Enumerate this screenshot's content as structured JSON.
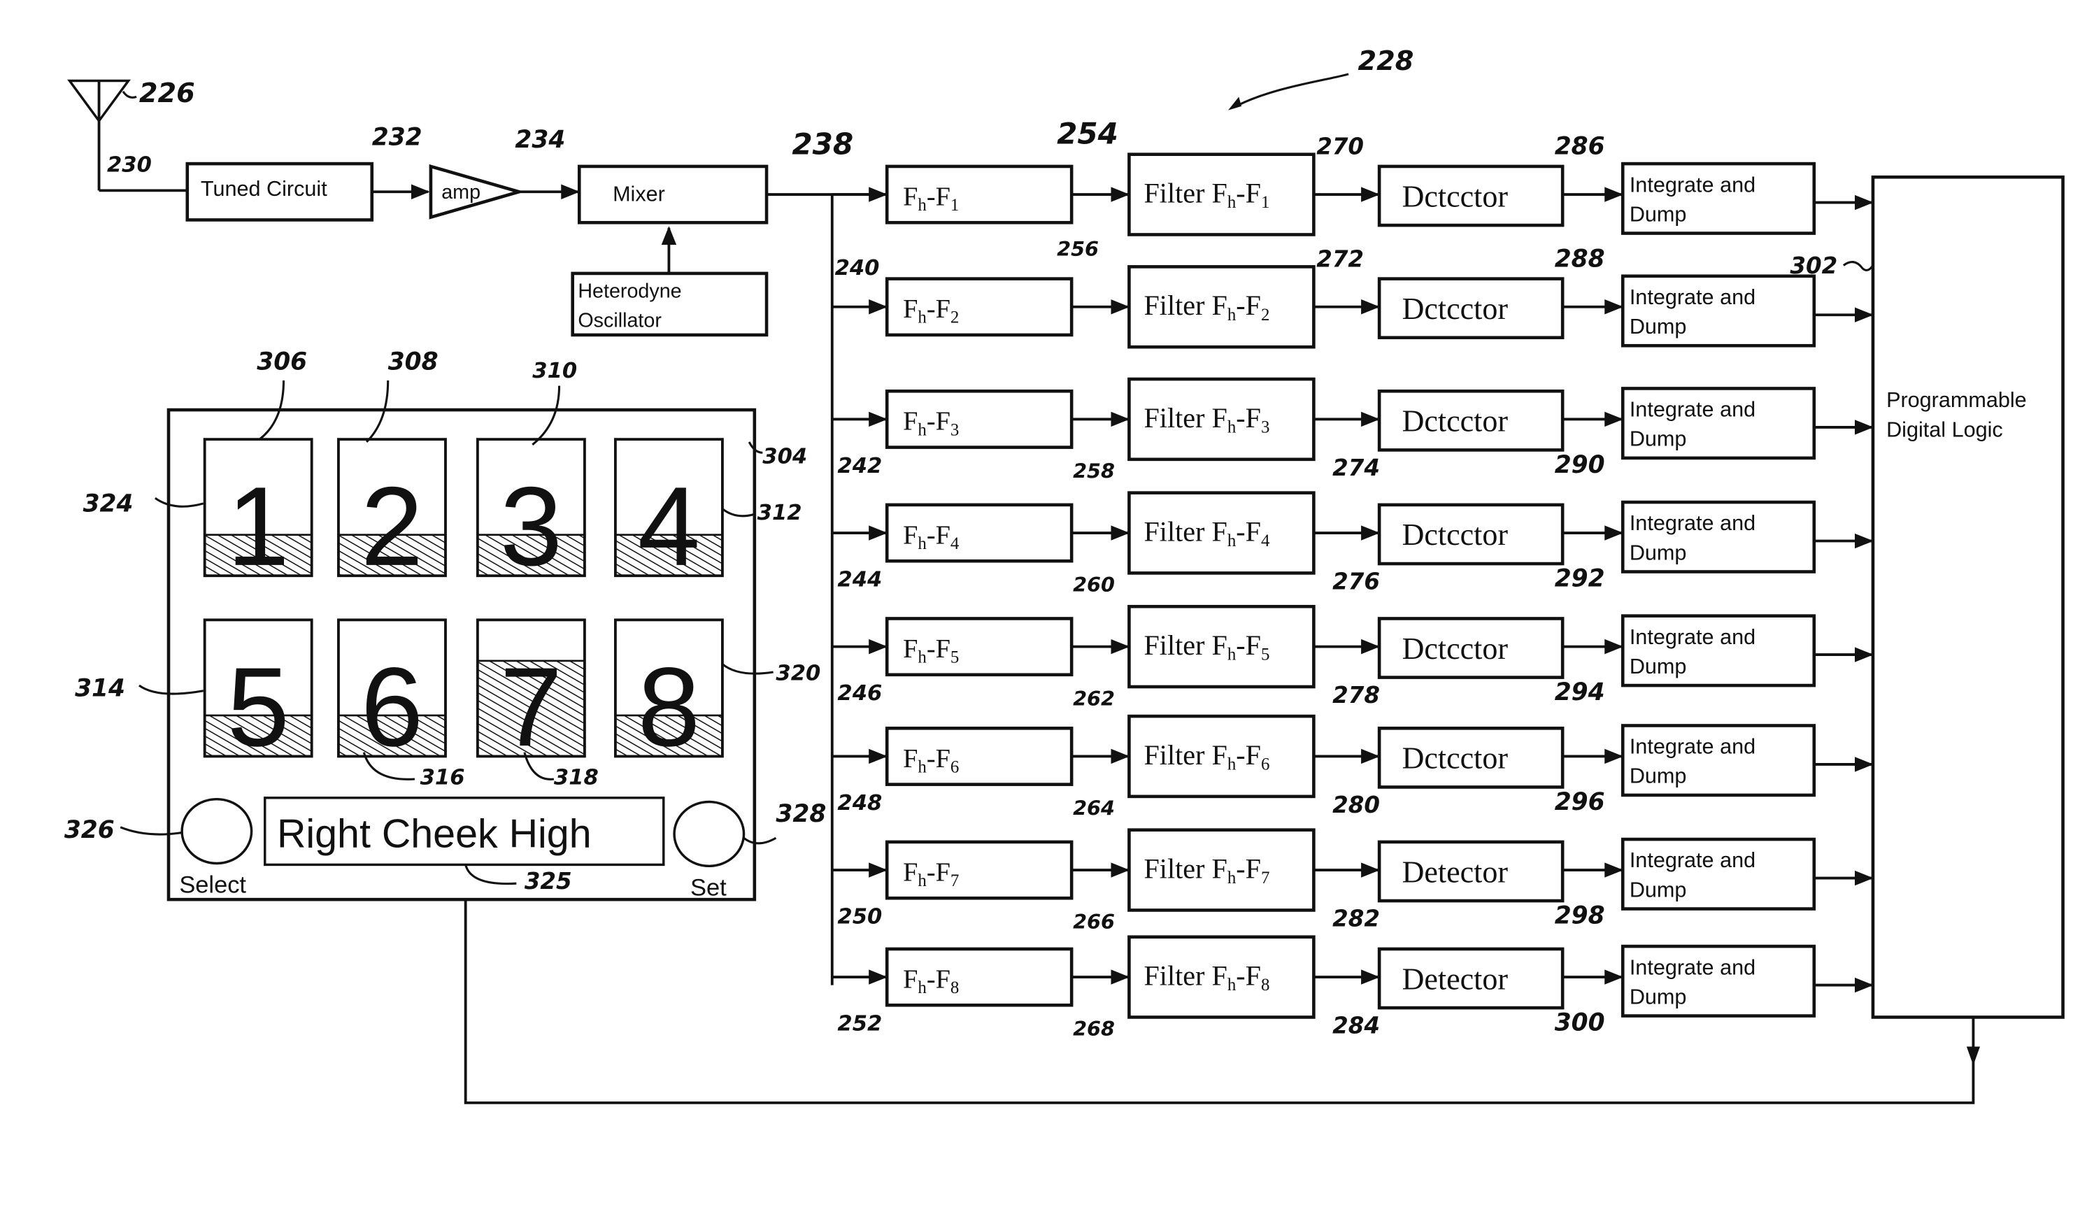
{
  "diagram": {
    "figure_ref": "228",
    "antenna": {
      "ref": "226"
    },
    "front_end": [
      {
        "id": "tuned",
        "label": "Tuned Circuit",
        "ref": "230"
      },
      {
        "id": "amp",
        "label": "amp",
        "ref": "232"
      },
      {
        "id": "mixer",
        "label": "Mixer",
        "ref": "234"
      },
      {
        "id": "osc",
        "label_line1": "Heterodyne",
        "label_line2": "Oscillator",
        "ref": ""
      }
    ],
    "bus_ref": "238",
    "channels": [
      {
        "sub": "1",
        "shift_ref": "238",
        "filter_ref": "254",
        "detector_ref": "270",
        "integrator_ref": "286",
        "detector_label": "Dctcctor"
      },
      {
        "sub": "2",
        "shift_ref": "240",
        "filter_ref": "256",
        "detector_ref": "272",
        "integrator_ref": "288",
        "detector_label": "Dctcctor"
      },
      {
        "sub": "3",
        "shift_ref": "242",
        "filter_ref": "258",
        "detector_ref": "274",
        "integrator_ref": "290",
        "detector_label": "Dctcctor"
      },
      {
        "sub": "4",
        "shift_ref": "244",
        "filter_ref": "260",
        "detector_ref": "276",
        "integrator_ref": "292",
        "detector_label": "Dctcctor"
      },
      {
        "sub": "5",
        "shift_ref": "246",
        "filter_ref": "262",
        "detector_ref": "278",
        "integrator_ref": "294",
        "detector_label": "Dctcctor"
      },
      {
        "sub": "6",
        "shift_ref": "248",
        "filter_ref": "264",
        "detector_ref": "280",
        "integrator_ref": "296",
        "detector_label": "Dctcctor"
      },
      {
        "sub": "7",
        "shift_ref": "250",
        "filter_ref": "266",
        "detector_ref": "282",
        "integrator_ref": "298",
        "detector_label": "Detector"
      },
      {
        "sub": "8",
        "shift_ref": "252",
        "filter_ref": "268",
        "detector_ref": "284",
        "integrator_ref": "300",
        "detector_label": "Detector"
      }
    ],
    "shift_prefix": "F",
    "shift_mid": "h",
    "filter_prefix": "Filter F",
    "integrator_line1": "Integrate and",
    "integrator_line2": "Dump",
    "logic": {
      "line1": "Programmable",
      "line2": "Digital Logic",
      "ref": "302"
    },
    "display_panel": {
      "ref": "304",
      "row1_ref_left": "324",
      "row1_ref_right": "312",
      "row2_ref_left": "314",
      "row2_ref_right": "320",
      "digit_refs": {
        "1": "306",
        "2": "308",
        "3": "310",
        "6": "316",
        "7": "318"
      },
      "digits": [
        {
          "label": "1",
          "level": 0.3
        },
        {
          "label": "2",
          "level": 0.3
        },
        {
          "label": "3",
          "level": 0.3
        },
        {
          "label": "4",
          "level": 0.3
        },
        {
          "label": "5",
          "level": 0.3
        },
        {
          "label": "6",
          "level": 0.3
        },
        {
          "label": "7",
          "level": 0.7
        },
        {
          "label": "8",
          "level": 0.3
        }
      ],
      "message": "Right Cheek High",
      "message_ref": "325",
      "select_label": "Select",
      "select_ref": "326",
      "set_label": "Set",
      "set_ref": "328"
    }
  }
}
